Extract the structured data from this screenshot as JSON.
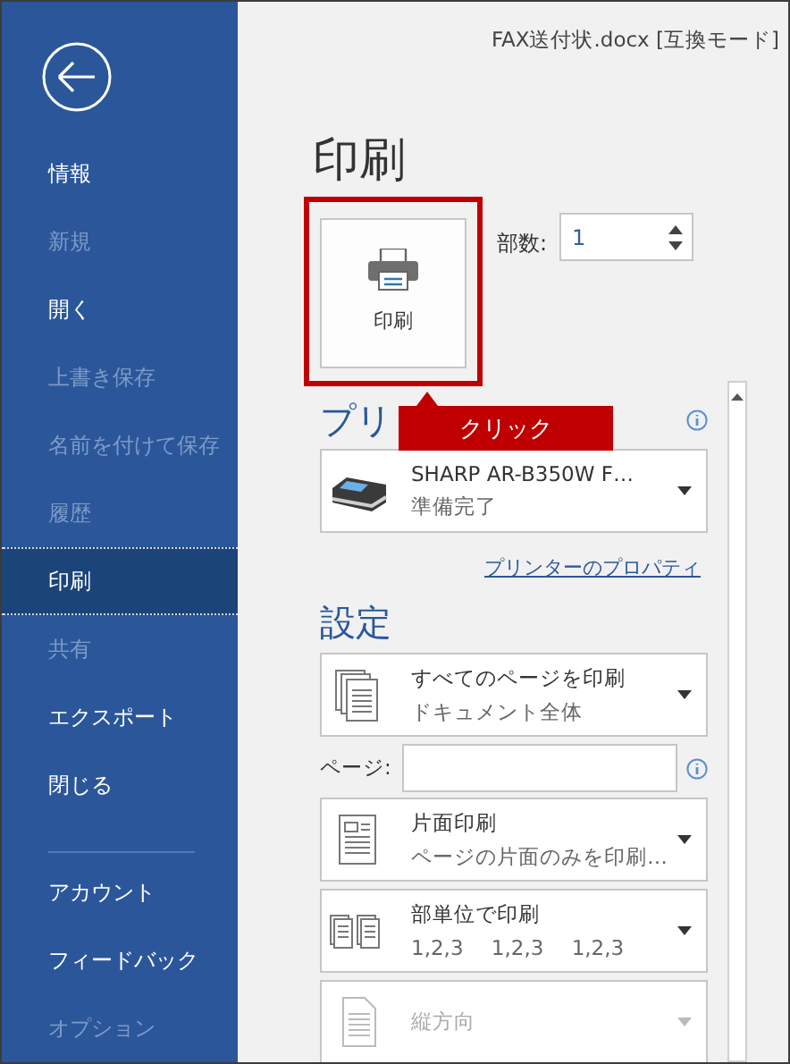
{
  "sidebar": {
    "items": [
      {
        "label": "情報",
        "disabled": false,
        "selected": false
      },
      {
        "label": "新規",
        "disabled": true,
        "selected": false
      },
      {
        "label": "開く",
        "disabled": false,
        "selected": false
      },
      {
        "label": "上書き保存",
        "disabled": true,
        "selected": false
      },
      {
        "label": "名前を付けて保存",
        "disabled": true,
        "selected": false
      },
      {
        "label": "履歴",
        "disabled": true,
        "selected": false
      },
      {
        "label": "印刷",
        "disabled": false,
        "selected": true
      },
      {
        "label": "共有",
        "disabled": true,
        "selected": false
      },
      {
        "label": "エクスポート",
        "disabled": false,
        "selected": false
      },
      {
        "label": "閉じる",
        "disabled": false,
        "selected": false
      }
    ],
    "bottom_items": [
      {
        "label": "アカウント",
        "disabled": false,
        "selected": false
      },
      {
        "label": "フィードバック",
        "disabled": false,
        "selected": false
      },
      {
        "label": "オプション",
        "disabled": true,
        "selected": false
      }
    ]
  },
  "document_title": "FAX送付状.docx [互換モード]",
  "heading": "印刷",
  "print_button": {
    "label": "印刷"
  },
  "copies": {
    "label": "部数:",
    "value": "1"
  },
  "callout": {
    "text": "クリック"
  },
  "printer": {
    "heading": "プリ",
    "name": "SHARP AR-B350W F…",
    "status": "準備完了",
    "properties_link": "プリンターのプロパティ"
  },
  "settings": {
    "heading": "設定",
    "options": [
      {
        "kind": "dropdown",
        "title": "すべてのページを印刷",
        "subtitle": "ドキュメント全体",
        "disabled": false
      },
      {
        "kind": "field",
        "label": "ページ:"
      },
      {
        "kind": "dropdown",
        "title": "片面印刷",
        "subtitle": "ページの片面のみを印刷…",
        "disabled": false
      },
      {
        "kind": "dropdown",
        "title": "部単位で印刷",
        "subtitle": "1,2,3 1,2,3 1,2,3",
        "disabled": false
      },
      {
        "kind": "dropdown",
        "title": "縦方向",
        "disabled": true
      }
    ]
  }
}
